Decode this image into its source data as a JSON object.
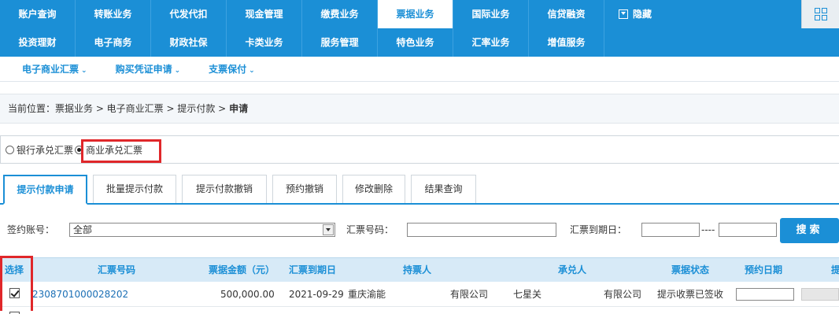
{
  "nav": {
    "row1": [
      "账户查询",
      "转账业务",
      "代发代扣",
      "现金管理",
      "缴费业务",
      "票据业务",
      "国际业务",
      "信贷融资"
    ],
    "hide_label": "隐藏",
    "row2": [
      "投资理财",
      "电子商务",
      "财政社保",
      "卡类业务",
      "服务管理",
      "特色业务",
      "汇率业务",
      "增值服务"
    ],
    "active_item": "票据业务",
    "accent_color": "#1b8fd6"
  },
  "subnav": [
    "电子商业汇票",
    "购买凭证申请",
    "支票保付"
  ],
  "breadcrumb": {
    "prefix": "当前位置：票据业务 > 电子商业汇票 > 提示付款 > ",
    "current": "申请"
  },
  "radios": {
    "bank": "银行承兑汇票",
    "commercial": "商业承兑汇票",
    "selected": "商业承兑汇票"
  },
  "tabs": [
    "提示付款申请",
    "批量提示付款",
    "提示付款撤销",
    "预约撤销",
    "修改删除",
    "结果查询"
  ],
  "active_tab": "提示付款申请",
  "search": {
    "account_label": "签约账号：",
    "account_value": "全部",
    "bill_no_label": "汇票号码：",
    "due_date_label": "汇票到期日：",
    "dash": "----",
    "button": "搜索"
  },
  "table": {
    "headers": [
      "选择",
      "汇票号码",
      "票据金额（元）",
      "汇票到期日",
      "持票人",
      "承兑人",
      "票据状态",
      "预约日期",
      "提"
    ],
    "rows": [
      {
        "bill_no": "2308701000028202",
        "amount": "500,000.00",
        "due_date": "2021-09-29",
        "holder_a": "重庆渝能",
        "holder_b": "有限公司",
        "acceptor_a": "七星关",
        "acceptor_b": "有限公司",
        "status": "提示收票已签收"
      }
    ]
  }
}
